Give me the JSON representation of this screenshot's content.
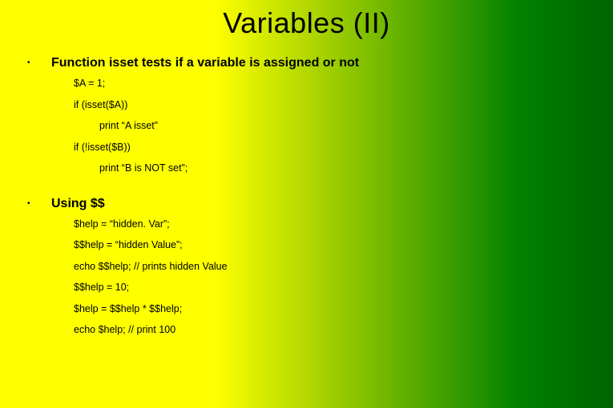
{
  "title": "Variables (II)",
  "bullets": {
    "b1": {
      "dot": "•",
      "text": "Function isset tests if a variable is assigned or not",
      "code": {
        "l1": "$A = 1;",
        "l2": "if (isset($A))",
        "l3": "print “A isset”",
        "l4": "if (!isset($B))",
        "l5": "print “B is NOT set”;"
      }
    },
    "b2": {
      "dot": "•",
      "text": "Using $$",
      "code": {
        "l1": "$help = “hidden. Var”;",
        "l2": "$$help = “hidden Value”;",
        "l3": "echo $$help; // prints  hidden Value",
        "l4": "$$help = 10;",
        "l5": "$help = $$help * $$help;",
        "l6": "echo $help; // print 100"
      }
    }
  }
}
